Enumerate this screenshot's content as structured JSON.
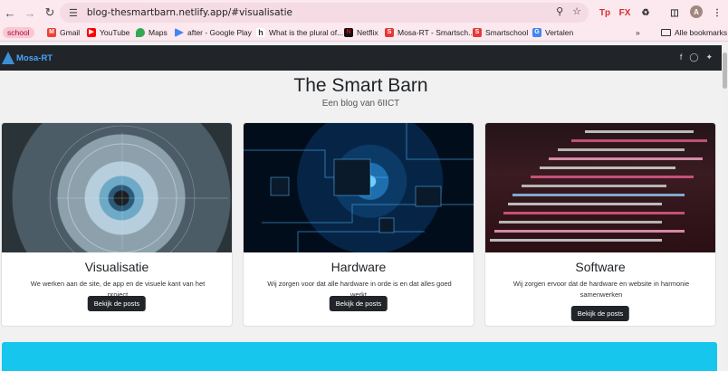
{
  "browser": {
    "url": "blog-thesmartbarn.netlify.app/#visualisatie",
    "avatar_letter": "A",
    "bookmarks": [
      {
        "label": "school",
        "icon": "school-chip"
      },
      {
        "label": "Gmail",
        "icon": "gmail-icon"
      },
      {
        "label": "YouTube",
        "icon": "youtube-icon"
      },
      {
        "label": "Maps",
        "icon": "maps-icon"
      },
      {
        "label": "after - Google Play",
        "icon": "google-play-icon"
      },
      {
        "label": "What is the plural of...",
        "icon": "h-icon"
      },
      {
        "label": "Netflix",
        "icon": "netflix-icon"
      },
      {
        "label": "Mosa-RT - Smartsch...",
        "icon": "smartschool-icon"
      },
      {
        "label": "Smartschool",
        "icon": "smartschool-icon"
      },
      {
        "label": "Vertalen",
        "icon": "translate-icon"
      }
    ],
    "all_bookmarks": "Alle bookmarks"
  },
  "site": {
    "logo_text": "Mosa-RT",
    "title": "The Smart Barn",
    "subtitle": "Een blog van 6IICT",
    "cards": [
      {
        "title": "Visualisatie",
        "text": "We werken aan de site, de app en de visuele kant van het project",
        "button": "Bekijk de posts"
      },
      {
        "title": "Hardware",
        "text": "Wij zorgen voor dat alle hardware in orde is en dat alles goed werkt.",
        "button": "Bekijk de posts"
      },
      {
        "title": "Software",
        "text": "Wij zorgen ervoor dat de hardware en website in harmonie samenwerken",
        "button": "Bekijk de posts"
      }
    ]
  },
  "colors": {
    "chrome_bg": "#fce8ef",
    "nav_bg": "#212529",
    "banner": "#16c6ec",
    "button_bg": "#212529"
  }
}
